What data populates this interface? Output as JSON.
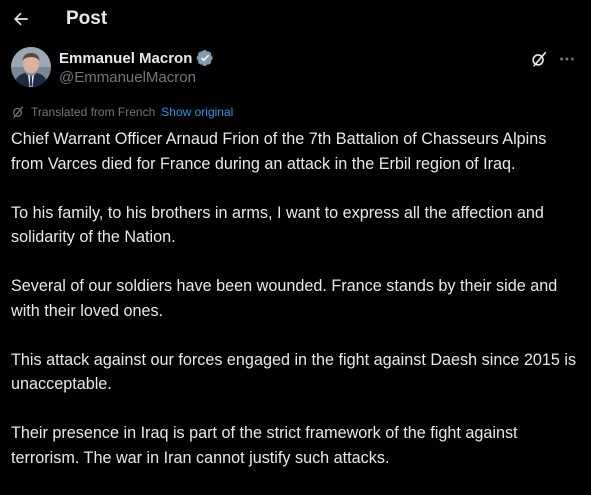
{
  "header": {
    "title": "Post"
  },
  "author": {
    "name": "Emmanuel Macron",
    "handle": "@EmmanuelMacron",
    "verified": true
  },
  "translation": {
    "label": "Translated from French",
    "show_original": "Show original"
  },
  "post": {
    "paragraphs": [
      "Chief Warrant Officer Arnaud Frion of the 7th Battalion of Chasseurs Alpins from Varces died for France during an attack in the Erbil region of Iraq.",
      "To his family, to his brothers in arms, I want to express all the affection and solidarity of the Nation.",
      "Several of our soldiers have been wounded. France stands by their side and with their loved ones.",
      "This attack against our forces engaged in the fight against Daesh since 2015 is unacceptable.",
      "Their presence in Iraq is part of the strict framework of the fight against terrorism. The war in Iran cannot justify such attacks."
    ]
  },
  "icons": {
    "back": "arrow-left-icon",
    "verified": "verified-badge-icon",
    "grok": "grok-icon",
    "more": "more-icon",
    "translate": "translate-icon"
  },
  "colors": {
    "background": "#000000",
    "text": "#e7e9ea",
    "muted": "#71767b",
    "link": "#1d9bf0",
    "verified": "#829aab"
  }
}
